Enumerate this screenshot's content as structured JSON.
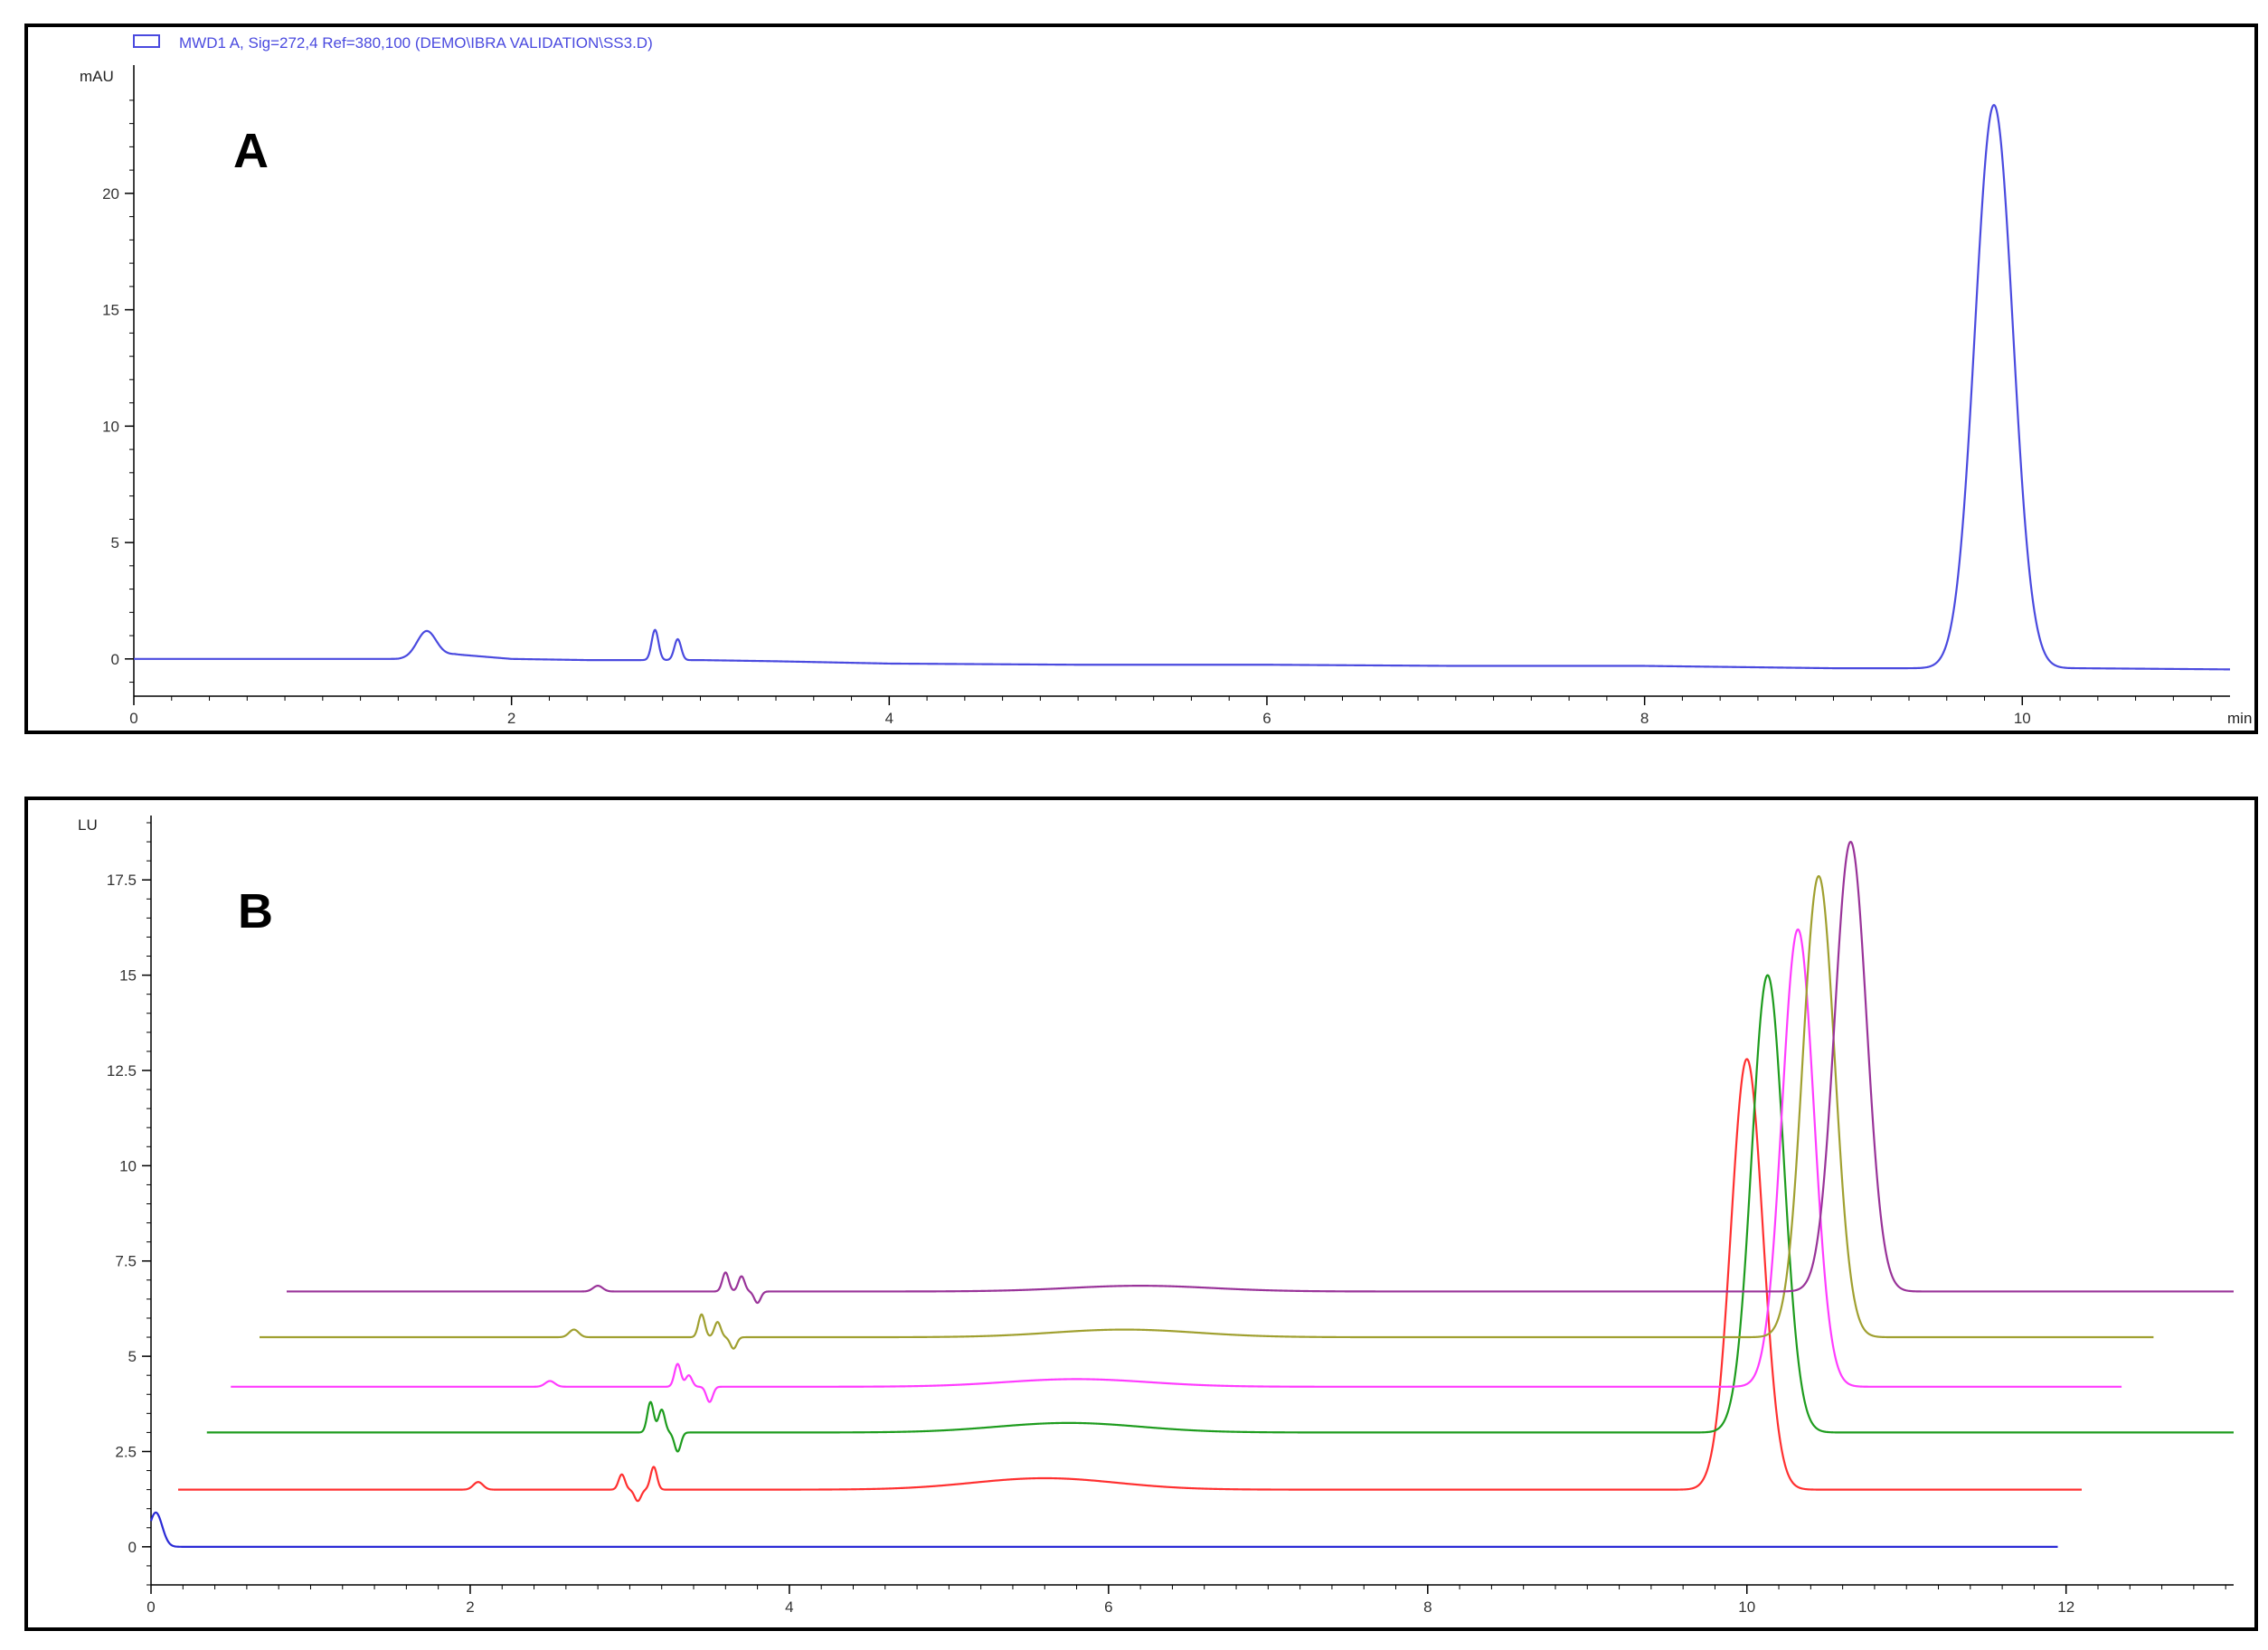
{
  "chart_data": [
    {
      "type": "line",
      "panel_label": "A",
      "legend": [
        "MWD1 A, Sig=272,4 Ref=380,100 (DEMO\\IBRA VALIDATION\\SS3.D)"
      ],
      "ylabel": "mAU",
      "xlabel": "min",
      "xlim": [
        0,
        11.1
      ],
      "ylim": [
        -1.6,
        25.2
      ],
      "xticks": [
        0,
        2,
        4,
        6,
        8,
        10
      ],
      "yticks": [
        0,
        5,
        10,
        15,
        20
      ],
      "xtick_labels": [
        "0",
        "2",
        "4",
        "6",
        "8",
        "10"
      ],
      "ytick_labels": [
        "0",
        "5",
        "10",
        "15",
        "20"
      ],
      "series": [
        {
          "color": "#4a4adf",
          "baseline": [
            [
              0,
              0.0
            ],
            [
              1.4,
              0.0
            ],
            [
              1.7,
              0.2
            ],
            [
              2.0,
              0.0
            ],
            [
              2.4,
              -0.05
            ],
            [
              3.0,
              -0.05
            ],
            [
              3.4,
              -0.1
            ],
            [
              4.0,
              -0.2
            ],
            [
              5.0,
              -0.25
            ],
            [
              6.0,
              -0.25
            ],
            [
              7.0,
              -0.3
            ],
            [
              8.0,
              -0.3
            ],
            [
              9.0,
              -0.4
            ],
            [
              9.5,
              -0.4
            ],
            [
              10.3,
              -0.4
            ],
            [
              11.1,
              -0.45
            ]
          ],
          "peaks": [
            {
              "rt": 1.55,
              "height": 1.1,
              "width": 0.05
            },
            {
              "rt": 2.76,
              "height": 1.3,
              "width": 0.018
            },
            {
              "rt": 2.88,
              "height": 0.9,
              "width": 0.018
            },
            {
              "rt": 9.85,
              "height": 24.2,
              "width": 0.1
            }
          ]
        }
      ]
    },
    {
      "type": "line",
      "panel_label": "B",
      "ylabel": "LU",
      "xlim": [
        0,
        13.05
      ],
      "ylim": [
        -1.0,
        19.0
      ],
      "xticks": [
        0,
        2,
        4,
        6,
        8,
        10,
        12
      ],
      "yticks": [
        0,
        2.5,
        5,
        7.5,
        10,
        12.5,
        15,
        17.5
      ],
      "xtick_labels": [
        "0",
        "2",
        "4",
        "6",
        "8",
        "10",
        "12"
      ],
      "ytick_labels": [
        "0",
        "2.5",
        "5",
        "7.5",
        "10",
        "12.5",
        "15",
        "17.5"
      ],
      "series": [
        {
          "color": "#2a2ad6",
          "x_start": 0.0,
          "x_end": 11.95,
          "baseline": 0.0,
          "peaks": [
            {
              "rt": 0.03,
              "height": 0.9,
              "width": 0.04
            }
          ]
        },
        {
          "color": "#ff3030",
          "x_start": 0.17,
          "x_end": 12.1,
          "baseline": 1.5,
          "hump": {
            "center": 5.6,
            "height": 0.3,
            "width": 0.45
          },
          "peaks": [
            {
              "rt": 2.05,
              "height": 0.2,
              "width": 0.03
            },
            {
              "rt": 2.95,
              "height": 0.4,
              "width": 0.02
            },
            {
              "rt": 3.05,
              "height": -0.3,
              "width": 0.02
            },
            {
              "rt": 3.15,
              "height": 0.6,
              "width": 0.02
            },
            {
              "rt": 10.0,
              "height": 11.3,
              "width": 0.1
            }
          ]
        },
        {
          "color": "#1e9c1e",
          "x_start": 0.35,
          "x_end": 13.05,
          "baseline": 3.0,
          "hump": {
            "center": 5.75,
            "height": 0.25,
            "width": 0.45
          },
          "peaks": [
            {
              "rt": 3.13,
              "height": 0.8,
              "width": 0.02
            },
            {
              "rt": 3.2,
              "height": 0.6,
              "width": 0.02
            },
            {
              "rt": 3.3,
              "height": -0.5,
              "width": 0.02
            },
            {
              "rt": 10.13,
              "height": 12.0,
              "width": 0.1
            }
          ]
        },
        {
          "color": "#ff3cff",
          "x_start": 0.5,
          "x_end": 12.35,
          "baseline": 4.2,
          "hump": {
            "center": 5.8,
            "height": 0.2,
            "width": 0.45
          },
          "peaks": [
            {
              "rt": 2.5,
              "height": 0.15,
              "width": 0.03
            },
            {
              "rt": 3.3,
              "height": 0.6,
              "width": 0.02
            },
            {
              "rt": 3.37,
              "height": 0.3,
              "width": 0.02
            },
            {
              "rt": 3.5,
              "height": -0.4,
              "width": 0.02
            },
            {
              "rt": 10.32,
              "height": 12.0,
              "width": 0.1
            }
          ]
        },
        {
          "color": "#a0a030",
          "x_start": 0.68,
          "x_end": 12.55,
          "baseline": 5.5,
          "hump": {
            "center": 6.1,
            "height": 0.2,
            "width": 0.45
          },
          "peaks": [
            {
              "rt": 2.65,
              "height": 0.2,
              "width": 0.03
            },
            {
              "rt": 3.45,
              "height": 0.6,
              "width": 0.02
            },
            {
              "rt": 3.55,
              "height": 0.4,
              "width": 0.02
            },
            {
              "rt": 3.65,
              "height": -0.3,
              "width": 0.02
            },
            {
              "rt": 10.45,
              "height": 12.1,
              "width": 0.1
            }
          ]
        },
        {
          "color": "#993399",
          "x_start": 0.85,
          "x_end": 13.05,
          "baseline": 6.7,
          "hump": {
            "center": 6.2,
            "height": 0.15,
            "width": 0.45
          },
          "peaks": [
            {
              "rt": 2.8,
              "height": 0.15,
              "width": 0.03
            },
            {
              "rt": 3.6,
              "height": 0.5,
              "width": 0.02
            },
            {
              "rt": 3.7,
              "height": 0.4,
              "width": 0.02
            },
            {
              "rt": 3.8,
              "height": -0.3,
              "width": 0.02
            },
            {
              "rt": 10.65,
              "height": 11.8,
              "width": 0.1
            }
          ]
        }
      ]
    }
  ]
}
